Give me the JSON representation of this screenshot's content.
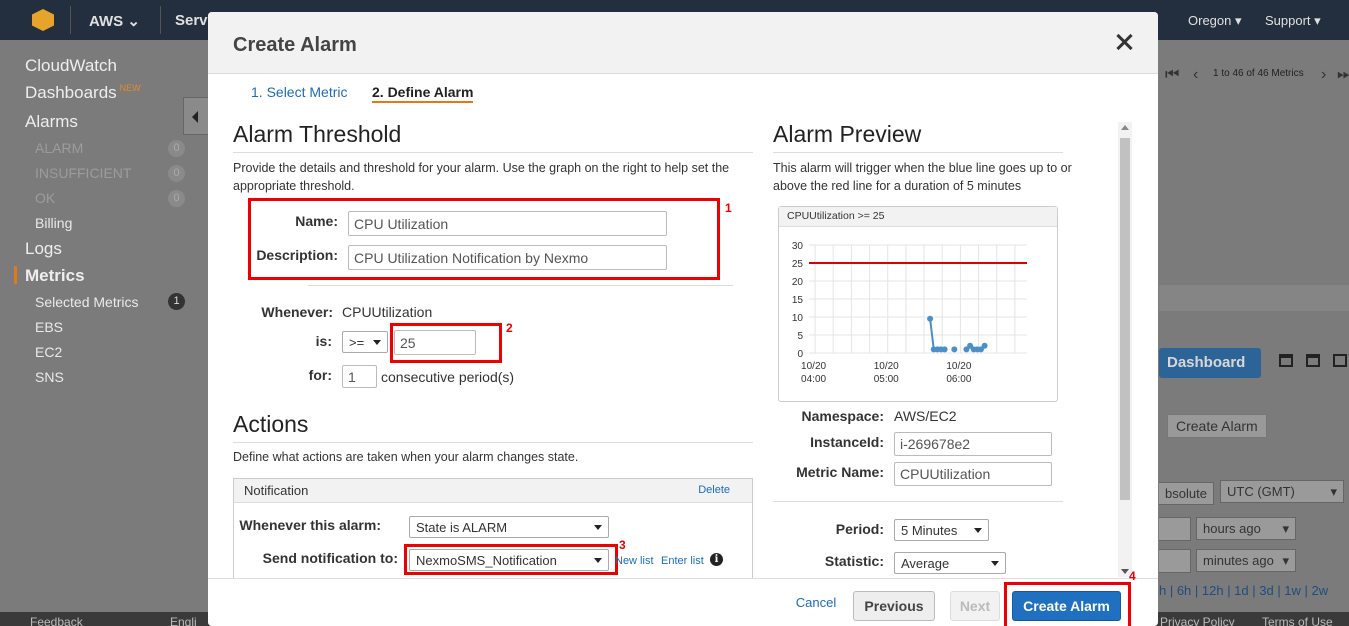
{
  "topnav": {
    "brand": "AWS",
    "services": "Serv",
    "region": "Oregon",
    "support": "Support"
  },
  "sidebar": {
    "cloudwatch": "CloudWatch",
    "dashboards": "Dashboards",
    "new_badge": "NEW",
    "alarms": "Alarms",
    "alarm_items": [
      {
        "label": "ALARM",
        "count": "0"
      },
      {
        "label": "INSUFFICIENT",
        "count": "0"
      },
      {
        "label": "OK",
        "count": "0"
      }
    ],
    "billing": "Billing",
    "logs": "Logs",
    "metrics": "Metrics",
    "metric_items": [
      {
        "label": "Selected Metrics",
        "count": "1"
      },
      {
        "label": "EBS"
      },
      {
        "label": "EC2"
      },
      {
        "label": "SNS"
      }
    ]
  },
  "footer": {
    "feedback": "Feedback",
    "english": "Engli",
    "privacy": "Privacy Policy",
    "terms": "Terms of Use"
  },
  "background_right": {
    "pager": "1 to 46 of 46 Metrics",
    "dashboard_button": "Dashboard",
    "create_alarm_button": "Create Alarm",
    "absolute_tab": "bsolute",
    "timezone": "UTC (GMT)",
    "hours_ago": "hours ago",
    "minutes_ago": "minutes ago",
    "time_links": "h | 6h | 12h | 1d | 3d | 1w | 2w"
  },
  "modal": {
    "title": "Create Alarm",
    "steps": [
      "1. Select Metric",
      "2. Define Alarm"
    ],
    "threshold": {
      "heading": "Alarm Threshold",
      "description": "Provide the details and threshold for your alarm. Use the graph on the right to help set the appropriate threshold.",
      "name_label": "Name:",
      "name_value": "CPU Utilization",
      "desc_label": "Description:",
      "desc_value": "CPU Utilization Notification by Nexmo",
      "whenever_label": "Whenever:",
      "whenever_value": "CPUUtilization",
      "is_label": "is:",
      "operator": ">=",
      "threshold_value": "25",
      "for_label": "for:",
      "periods_value": "1",
      "periods_suffix": "consecutive period(s)"
    },
    "actions": {
      "heading": "Actions",
      "description": "Define what actions are taken when your alarm changes state.",
      "notification_title": "Notification",
      "delete_link": "Delete",
      "whenever_alarm_label": "Whenever this alarm:",
      "state_value": "State is ALARM",
      "send_to_label": "Send notification to:",
      "send_to_value": "NexmoSMS_Notification",
      "new_list": "New list",
      "enter_list": "Enter list"
    },
    "preview": {
      "heading": "Alarm Preview",
      "description": "This alarm will trigger when the blue line goes up to or above the red line for a duration of 5 minutes",
      "chart_title": "CPUUtilization >= 25",
      "namespace_label": "Namespace:",
      "namespace_value": "AWS/EC2",
      "instance_label": "InstanceId:",
      "instance_value": "i-269678e2",
      "metric_label": "Metric Name:",
      "metric_value": "CPUUtilization",
      "period_label": "Period:",
      "period_value": "5 Minutes",
      "statistic_label": "Statistic:",
      "statistic_value": "Average"
    },
    "buttons": {
      "cancel": "Cancel",
      "previous": "Previous",
      "next": "Next",
      "create": "Create Alarm"
    },
    "annotations": [
      "1",
      "2",
      "3",
      "4"
    ]
  },
  "colors": {
    "threshold_line": "#dd0000",
    "series": "#4a90c8",
    "annotation_red": "#ee0000",
    "primary_button": "#1f70c1"
  },
  "chart_data": {
    "type": "line",
    "title": "CPUUtilization >= 25",
    "x_ticks": [
      "10/20 04:00",
      "10/20 05:00",
      "10/20 06:00"
    ],
    "y_ticks": [
      0,
      5,
      10,
      15,
      20,
      25,
      30
    ],
    "ylim": [
      0,
      30
    ],
    "threshold": 25,
    "series": [
      {
        "values": [
          {
            "x": "05:35",
            "y": 9.5
          },
          {
            "x": "05:38",
            "y": 1
          },
          {
            "x": "05:41",
            "y": 1
          },
          {
            "x": "05:44",
            "y": 1
          },
          {
            "x": "05:47",
            "y": 1
          }
        ]
      },
      {
        "values": [
          {
            "x": "05:55",
            "y": 1
          }
        ]
      },
      {
        "values": [
          {
            "x": "06:05",
            "y": 1
          },
          {
            "x": "06:08",
            "y": 2
          },
          {
            "x": "06:11",
            "y": 1
          },
          {
            "x": "06:14",
            "y": 1
          },
          {
            "x": "06:17",
            "y": 1
          },
          {
            "x": "06:20",
            "y": 2
          }
        ]
      }
    ],
    "grid": true
  }
}
